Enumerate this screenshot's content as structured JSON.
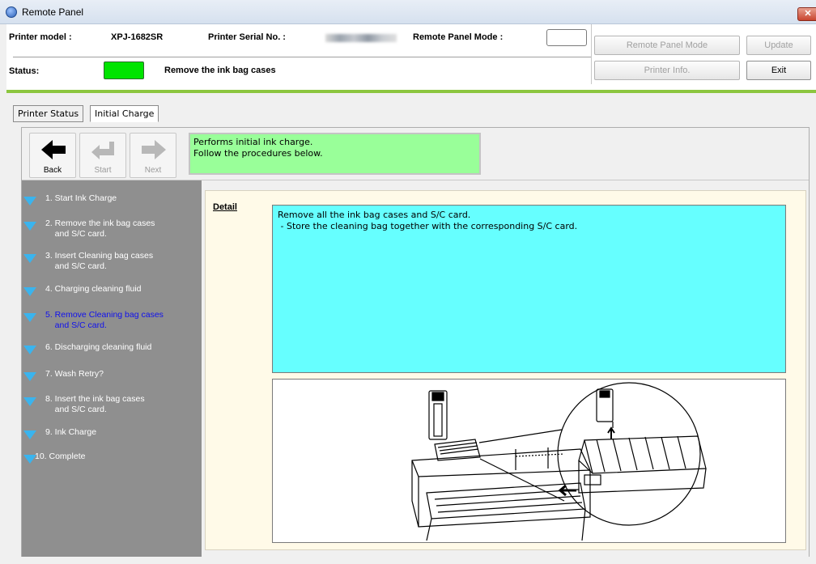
{
  "window": {
    "title": "Remote Panel",
    "close_label": "✕"
  },
  "header": {
    "printer_model_label": "Printer model :",
    "printer_model_value": "XPJ-1682SR",
    "serial_label": "Printer Serial No. :",
    "remote_mode_label": "Remote Panel Mode :",
    "status_label": "Status:",
    "status_text": "Remove the ink bag cases",
    "status_color": "#00e400"
  },
  "buttons": {
    "remote_panel_mode": "Remote Panel Mode",
    "update": "Update",
    "printer_info": "Printer Info.",
    "exit": "Exit"
  },
  "tabs": [
    {
      "label": "Printer Status",
      "active": false
    },
    {
      "label": "Initial Charge",
      "active": true
    }
  ],
  "toolbar": {
    "back_label": "Back",
    "start_label": "Start",
    "next_label": "Next"
  },
  "instruction": {
    "line1": "Performs initial ink charge.",
    "line2": "Follow the procedures below.",
    "color": "#99ff99"
  },
  "steps": [
    {
      "label": "1. Start Ink Charge",
      "current": false
    },
    {
      "label": "2. Remove the ink bag cases\n    and S/C card.",
      "current": false
    },
    {
      "label": "3. Insert Cleaning bag cases\n    and S/C card.",
      "current": false
    },
    {
      "label": "4. Charging cleaning fluid",
      "current": false
    },
    {
      "label": "5. Remove Cleaning bag cases\n    and S/C card.",
      "current": true
    },
    {
      "label": "6. Discharging cleaning fluid",
      "current": false
    },
    {
      "label": "7. Wash Retry?",
      "current": false
    },
    {
      "label": "8. Insert the ink bag cases\n    and S/C card.",
      "current": false
    },
    {
      "label": "9. Ink Charge",
      "current": false
    },
    {
      "label": "10. Complete",
      "current": false
    }
  ],
  "detail": {
    "label": "Detail",
    "text": "Remove all the ink bag cases and S/C card.\n - Store the cleaning bag together with the corresponding S/C card.",
    "bg_color": "#66ffff"
  },
  "colors": {
    "accent_line": "#8cc63f",
    "step_icon": "#3ab4ee",
    "current_step_text": "#1010ee"
  }
}
